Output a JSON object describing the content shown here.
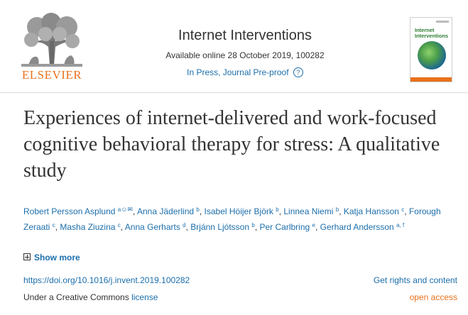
{
  "publisher": {
    "name": "ELSEVIER",
    "accent": "#e9711c"
  },
  "journal": {
    "title": "Internet Interventions",
    "availability": "Available online 28 October 2019, 100282",
    "status": "In Press, Journal Pre-proof",
    "help_icon": "question-circle-icon",
    "cover_title_line1": "Internet",
    "cover_title_line2": "Interventions"
  },
  "article": {
    "title": "Experiences of internet-delivered and work-focused cognitive behavioral therapy for stress: A qualitative study"
  },
  "authors": [
    {
      "name": "Robert Persson Asplund",
      "aff": "a",
      "icons": [
        "person-icon",
        "envelope-icon"
      ]
    },
    {
      "name": "Anna Jäderlind",
      "aff": "b"
    },
    {
      "name": "Isabel Höijer Björk",
      "aff": "b"
    },
    {
      "name": "Linnea Niemi",
      "aff": "b"
    },
    {
      "name": "Katja Hansson",
      "aff": "c"
    },
    {
      "name": "Forough Zeraati",
      "aff": "c"
    },
    {
      "name": "Masha Ziuzina",
      "aff": "c"
    },
    {
      "name": "Anna Gerharts",
      "aff": "d"
    },
    {
      "name": "Brjánn Ljótsson",
      "aff": "b"
    },
    {
      "name": "Per Carlbring",
      "aff": "e"
    },
    {
      "name": "Gerhard Andersson",
      "aff": "a, f"
    }
  ],
  "actions": {
    "show_more": "Show more",
    "doi": "https://doi.org/10.1016/j.invent.2019.100282",
    "rights": "Get rights and content",
    "license_prefix": "Under a Creative Commons ",
    "license_link": "license",
    "open_access": "open access"
  },
  "colors": {
    "link": "#1c6eab",
    "text": "#333333",
    "open_access": "#e9711c"
  }
}
